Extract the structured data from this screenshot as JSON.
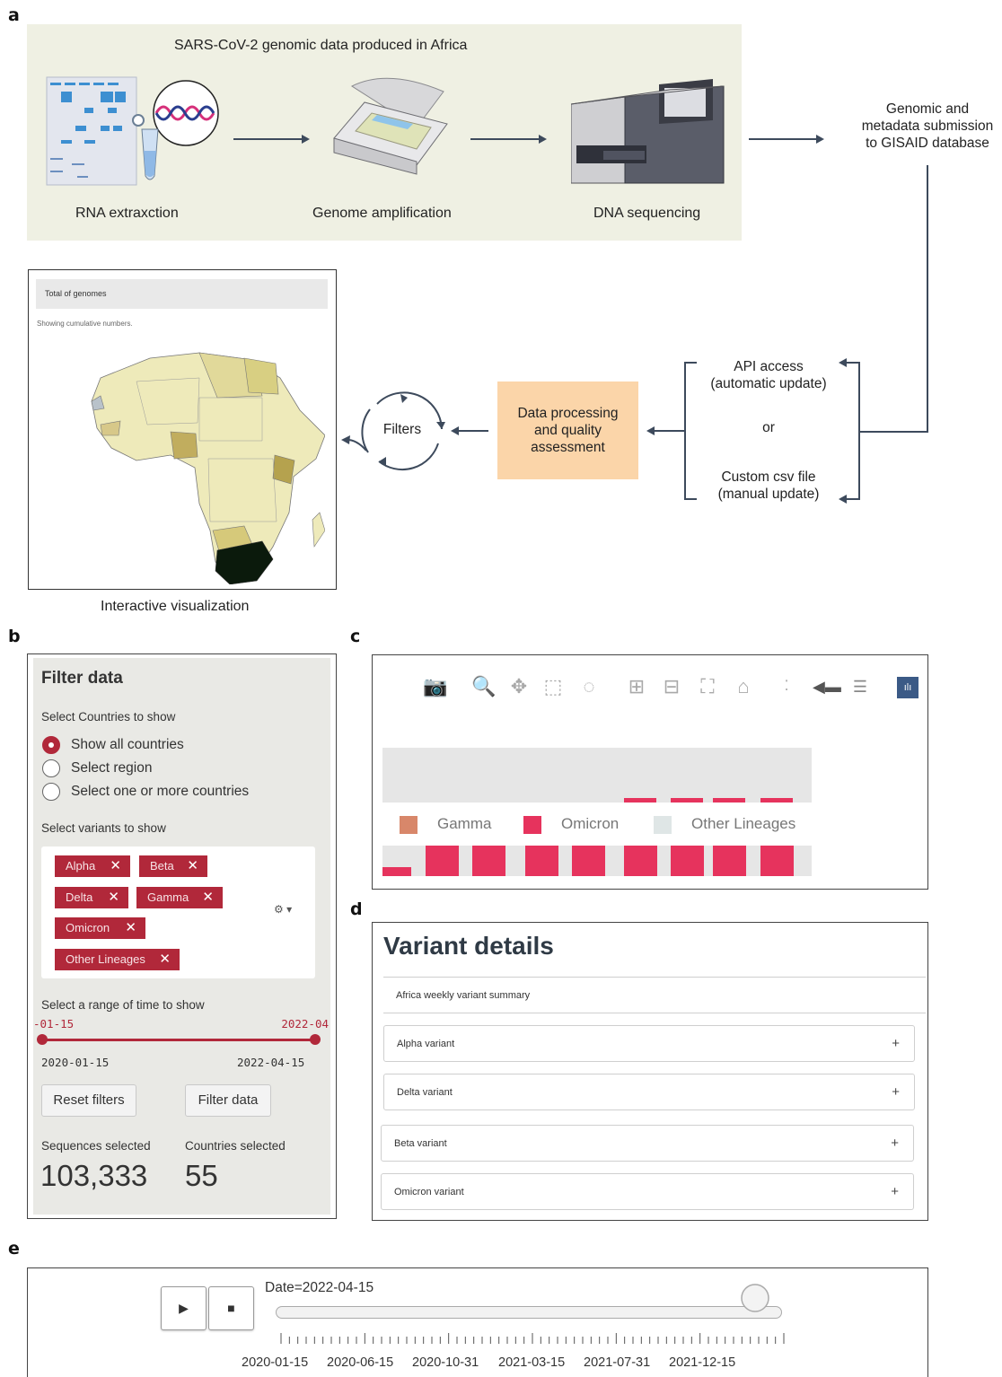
{
  "panels": {
    "a": "a",
    "b": "b",
    "c": "c",
    "d": "d",
    "e": "e"
  },
  "workflow": {
    "header": "SARS-CoV-2 genomic data produced in Africa",
    "steps": [
      "RNA extraxction",
      "Genome amplification",
      "DNA sequencing"
    ],
    "submission": [
      "Genomic and",
      "metadata submission",
      "to GISAID database"
    ],
    "api": [
      "API access",
      "(automatic update)"
    ],
    "or": "or",
    "csv": [
      "Custom csv file",
      "(manual update)"
    ],
    "processing": [
      "Data processing",
      "and quality",
      "assessment"
    ],
    "filters": "Filters",
    "visualization_caption": "Interactive visualization",
    "map": {
      "header": "Total of genomes",
      "subtitle": "Showing cumulative numbers."
    }
  },
  "filter_panel": {
    "title": "Filter data",
    "countries_label": "Select Countries to show",
    "radio_options": [
      "Show all countries",
      "Select region",
      "Select one or more countries"
    ],
    "selected_option": "Show all countries",
    "variants_label": "Select variants to show",
    "variants": [
      "Alpha",
      "Beta",
      "Delta",
      "Gamma",
      "Omicron",
      "Other Lineages"
    ],
    "time_label": "Select a range of time to show",
    "range_top_left": "-01-15",
    "range_top_right": "2022-04",
    "range_start": "2020-01-15",
    "range_end": "2022-04-15",
    "reset_label": "Reset filters",
    "filter_label": "Filter data",
    "sequences_label": "Sequences selected",
    "countries_selected_label": "Countries selected",
    "sequences_value": "103,333",
    "countries_value": "55",
    "accent": "#b1283a"
  },
  "chart_toolbar": {
    "icons": [
      "camera-icon",
      "zoom-icon",
      "pan-icon",
      "box-select-icon",
      "lasso-icon",
      "zoom-in-icon",
      "zoom-out-icon",
      "autoscale-icon",
      "reset-axes-icon",
      "spike-lines-icon",
      "hover-closest-icon",
      "hover-compare-icon",
      "plotly-logo-icon"
    ],
    "legend": [
      {
        "name": "Gamma",
        "color": "#d8876a"
      },
      {
        "name": "Omicron",
        "color": "#e6335d"
      },
      {
        "name": "Other Lineages",
        "color": "#dfe6e6"
      }
    ]
  },
  "variant_details": {
    "title": "Variant details",
    "summary": "Africa weekly variant summary",
    "rows": [
      "Alpha variant",
      "Delta variant",
      "Beta variant",
      "Omicron variant"
    ],
    "expand": "+"
  },
  "animation": {
    "date_label": "Date=2022-04-15",
    "play": "▶",
    "stop": "■",
    "ticks": [
      "2020-01-15",
      "2020-06-15",
      "2020-10-31",
      "2021-03-15",
      "2021-07-31",
      "2021-12-15"
    ],
    "position": 1.0
  }
}
